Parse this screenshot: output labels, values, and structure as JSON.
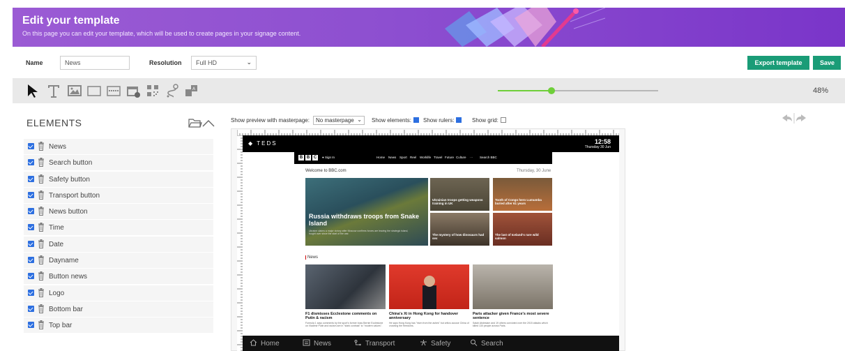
{
  "header": {
    "title": "Edit your template",
    "subtitle": "On this page you can edit your template, which will be used to create pages in your signage content."
  },
  "form": {
    "name_label": "Name",
    "name_value": "News",
    "resolution_label": "Resolution",
    "resolution_value": "Full HD",
    "export_label": "Export template",
    "save_label": "Save"
  },
  "toolbar": {
    "tools": [
      "pointer-icon",
      "text-icon",
      "image-icon",
      "rectangle-icon",
      "ticker-icon",
      "calendar-icon",
      "qr-code-icon",
      "route-icon",
      "widget-icon"
    ],
    "zoom_percent": 48,
    "zoom_label": "48%"
  },
  "elements": {
    "title": "ELEMENTS",
    "items": [
      {
        "label": "News"
      },
      {
        "label": "Search button"
      },
      {
        "label": "Safety button"
      },
      {
        "label": "Transport button"
      },
      {
        "label": "News button"
      },
      {
        "label": "Time"
      },
      {
        "label": "Date"
      },
      {
        "label": "Dayname"
      },
      {
        "label": "Button news"
      },
      {
        "label": "Logo"
      },
      {
        "label": "Bottom bar"
      },
      {
        "label": "Top bar"
      }
    ]
  },
  "preview": {
    "masterpage_label": "Show preview with masterpage:",
    "masterpage_value": "No masterpage",
    "show_elements_label": "Show elements:",
    "show_rulers_label": "Show rulers:",
    "show_grid_label": "Show grid:"
  },
  "screen": {
    "logo": "TEDS",
    "time": "12:58",
    "date": "Thursday  30 Jun",
    "bbc": {
      "letters": [
        "B",
        "B",
        "C"
      ],
      "signin": "Sign In",
      "nav": [
        "Home",
        "News",
        "Sport",
        "Reel",
        "Worklife",
        "Travel",
        "Future",
        "Culture",
        "···",
        "Search BBC"
      ],
      "welcome": "Welcome to BBC.com",
      "date": "Thursday, 30 June",
      "hero_title": "Russia withdraws troops from Snake Island",
      "hero_desc": "Ukraine claims a major victory after Moscow confirms forces are leaving the strategic island, fought over since the start of the war.",
      "thumbs": [
        {
          "title": "Ukrainian troops getting weapons training in UK"
        },
        {
          "title": "Tooth of Congo hero Lumumba buried after 61 years"
        },
        {
          "title": "The mystery of how dinosaurs had sex"
        },
        {
          "title": "The last of Iceland's rare wild salmon"
        }
      ],
      "news_heading": "News",
      "news": [
        {
          "title": "F1 dismisses Ecclestone comments on Putin & racism",
          "desc": "Formula 1 says comments by the sport's former boss Bernie Ecclestone on Vladimir Putin and racism are in \"stark contrast\" to \"modern values\"."
        },
        {
          "title": "China's Xi in Hong Kong for handover anniversary",
          "desc": "He says Hong Kong has \"risen from the ashes\" but critics accuse China of crushing the freedoms."
        },
        {
          "title": "Paris attacker given France's most severe sentence",
          "desc": "Salah Abdeslam and 19 others convicted over the 2015 attacks which killed 130 people across Paris."
        }
      ]
    },
    "bottom_nav": [
      {
        "label": "Home",
        "icon": "home-icon"
      },
      {
        "label": "News",
        "icon": "news-icon"
      },
      {
        "label": "Transport",
        "icon": "transport-icon"
      },
      {
        "label": "Safety",
        "icon": "safety-icon"
      },
      {
        "label": "Search",
        "icon": "search-icon"
      }
    ]
  },
  "colors": {
    "header": "#8d4fd0",
    "accent_green": "#1a9c77",
    "slider": "#6fcf3a",
    "checkbox": "#2d6fe0"
  }
}
